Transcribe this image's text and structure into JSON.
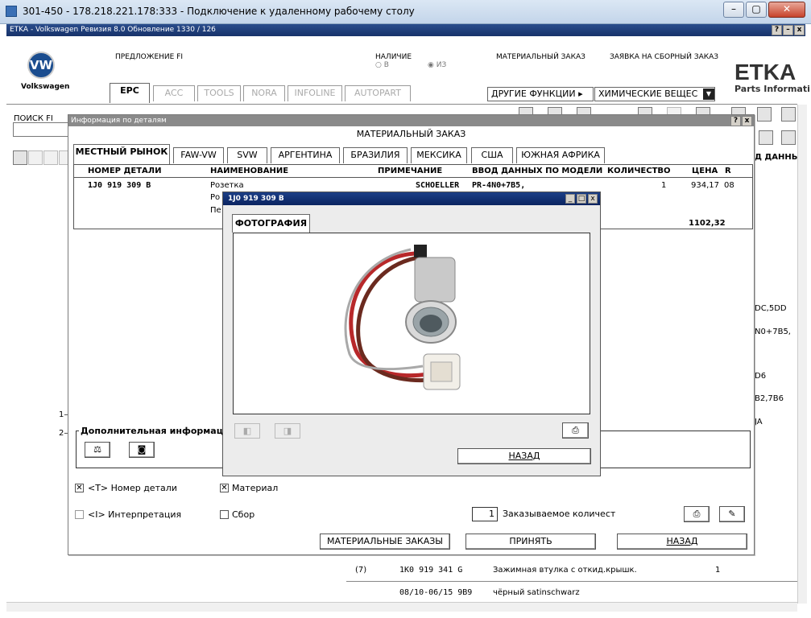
{
  "rdp": {
    "title": "301-450 - 178.218.221.178:333 - Подключение к удаленному рабочему столу"
  },
  "etka": {
    "title": "ETKA - Volkswagen Ревизия 8.0 Обновление 1330 / 126",
    "brand": "Volkswagen",
    "logo": "ETKA",
    "logo_sub": "Parts Informati",
    "proposal": "ПРЕДЛОЖЕНИЕ FI",
    "availability": "НАЛИЧИЕ",
    "avail_v": "В",
    "avail_iz": "ИЗ",
    "material_order": "МАТЕРИАЛЬНЫЙ ЗАКАЗ",
    "assembly_order": "ЗАЯВКА НА СБОРНЫЙ ЗАКАЗ",
    "tabs": [
      "EPC",
      "ACC",
      "TOOLS",
      "NORA",
      "INFOLINE",
      "AUTOPART"
    ],
    "other_functions": "ДРУГИЕ ФУНКЦИИ",
    "chem_dropdown": "ХИМИЧЕСКИЕ ВЕЩЕС",
    "search_label": "ПОИСК FI",
    "bg_right": [
      "Д ДАННЫХ",
      "DC,5DD",
      "N0+7B5,",
      "D6",
      "B2,7B6",
      "JA"
    ],
    "bg_rows": [
      {
        "pos": "(7)",
        "part": "1K0 919 341 G",
        "desc": "Зажимная втулка с откид.крышк.",
        "qty": "1"
      },
      {
        "pos": "",
        "part": "08/10-06/15 9B9",
        "desc": "чёрный satinschwarz",
        "qty": ""
      }
    ],
    "bg_left": [
      "1–",
      "2–"
    ]
  },
  "dialog": {
    "title": "Информация по деталям",
    "heading": "МАТЕРИАЛЬНЫЙ ЗАКАЗ",
    "market_tabs": [
      "МЕСТНЫЙ РЫНОК",
      "FAW-VW",
      "SVW",
      "АРГЕНТИНА",
      "БРАЗИЛИЯ",
      "МЕКСИКА",
      "США",
      "ЮЖНАЯ АФРИКА"
    ],
    "columns": [
      "НОМЕР ДЕТАЛИ",
      "НАИМЕНОВАНИЕ",
      "ПРИМЕЧАНИЕ",
      "ВВОД ДАННЫХ ПО МОДЕЛИ",
      "КОЛИЧЕСТВО",
      "ЦЕНА",
      "R"
    ],
    "row": {
      "part": "1J0 919 309 B",
      "names": [
        "Розетка",
        "Ро",
        "Пе"
      ],
      "note": "SCHOELLER",
      "model": "PR-4N0+7B5,",
      "qty": "1",
      "price": "934,17",
      "r": "08"
    },
    "total": "1102,32",
    "extra_info": "Дополнительная информация",
    "cb_part_number": "<T> Номер детали",
    "cb_material": "Материал",
    "cb_interpretation": "<I> Интерпретация",
    "cb_assembly": "Сбор",
    "order_qty_value": "1",
    "order_qty_label": "Заказываемое количест",
    "btn_material_orders": "МАТЕРИАЛЬНЫЕ ЗАКАЗЫ",
    "btn_accept": "ПРИНЯТЬ",
    "btn_back": "НАЗАД"
  },
  "photo": {
    "title": "1J0 919 309 B",
    "tab": "ФОТОГРАФИЯ",
    "btn_back": "НАЗАД"
  },
  "icons": {
    "print": "printer-icon",
    "camera": "camera-icon",
    "edit": "edit-icon"
  }
}
